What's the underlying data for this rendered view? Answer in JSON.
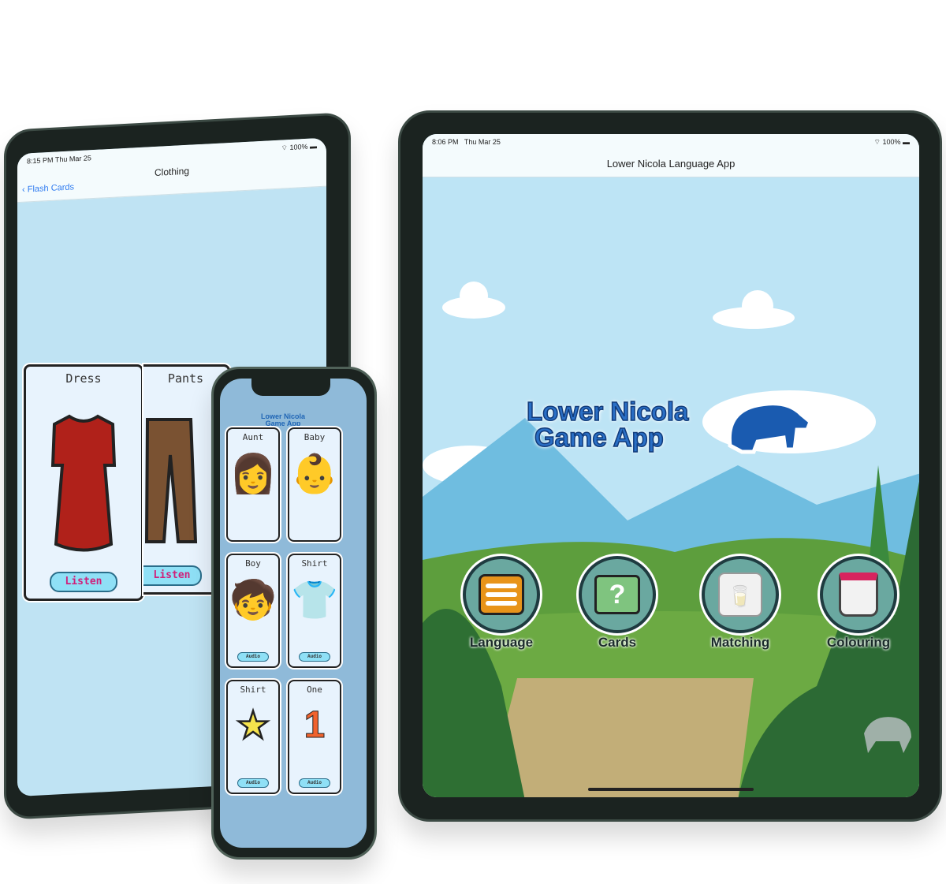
{
  "left_tablet": {
    "status_time": "8:15 PM",
    "status_date": "Thu Mar 25",
    "battery": "100%",
    "back_label": "Flash Cards",
    "title": "Clothing",
    "cards": [
      {
        "title": "Dress",
        "button": "Listen",
        "color": "#b0211a"
      },
      {
        "title": "Pants",
        "button": "Listen",
        "color": "#7a5232"
      }
    ]
  },
  "phone": {
    "logo": "Lower Nicola Game App",
    "cards": [
      {
        "title": "Aunt",
        "button": ""
      },
      {
        "title": "Baby",
        "button": ""
      },
      {
        "title": "Boy",
        "button": "Audio"
      },
      {
        "title": "Shirt",
        "button": "Audio"
      },
      {
        "title": "Shirt",
        "button": "Audio"
      },
      {
        "title": "One",
        "button": "Audio"
      }
    ]
  },
  "right_tablet": {
    "status_time": "8:06 PM",
    "status_date": "Thu Mar 25",
    "battery": "100%",
    "title": "Lower Nicola Language App",
    "logo_line1": "Lower Nicola",
    "logo_line2": "Game App",
    "menu": [
      {
        "label": "Language",
        "icon": "menu-lines-icon"
      },
      {
        "label": "Cards",
        "icon": "cards-question-icon"
      },
      {
        "label": "Matching",
        "icon": "milk-carton-icon"
      },
      {
        "label": "Colouring",
        "icon": "paint-bucket-icon"
      }
    ]
  }
}
